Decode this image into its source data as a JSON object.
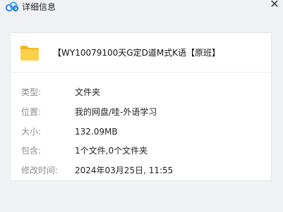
{
  "window": {
    "title": "详细信息",
    "close_glyph": "✕",
    "icon": "cloud-app-icon"
  },
  "file": {
    "icon": "folder-icon",
    "name": "【WY10079100天G定D道M式K语【原班】"
  },
  "properties": [
    {
      "label": "类型:",
      "value": "文件夹"
    },
    {
      "label": "位置:",
      "value": "我的网盘/哇-外语学习"
    },
    {
      "label": "大小:",
      "value": "132.09MB"
    },
    {
      "label": "包含:",
      "value": "1个文件,0个文件夹"
    },
    {
      "label": "修改时间:",
      "value": "2024年03月25日, 11:55"
    }
  ],
  "colors": {
    "background": "#f1f2f5",
    "card": "#ffffff",
    "label": "#8a8d93",
    "folder": "#f7c531"
  }
}
